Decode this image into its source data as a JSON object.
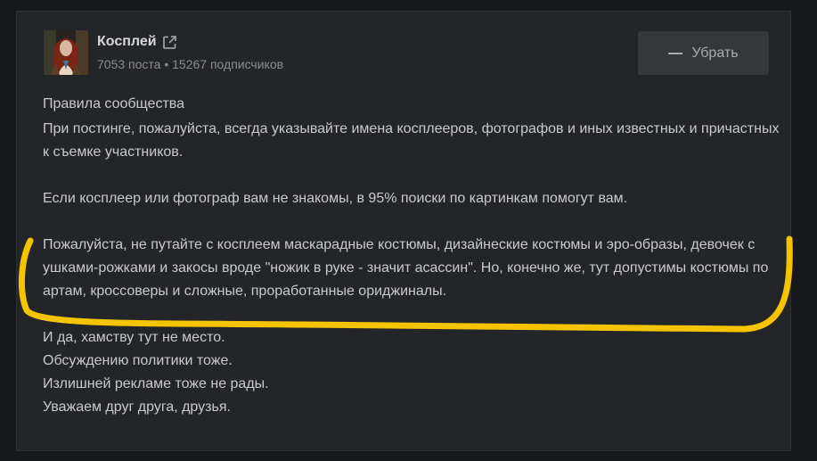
{
  "community": {
    "name": "Косплей",
    "posts": "7053 поста",
    "separator": "•",
    "subscribers": "15267 подписчиков"
  },
  "actions": {
    "remove_label": "Убрать"
  },
  "rules": {
    "title": "Правила сообщества",
    "paragraph_1": "При постинге, пожалуйста, всегда указывайте имена косплееров, фотографов и иных известных и причастных к съемке участников.",
    "paragraph_2": "Если косплеер или фотограф вам не знакомы, в 95% поиски по картинкам помогут вам.",
    "paragraph_3": "Пожалуйста, не путайте с косплеем маскарадные костюмы, дизайнеские костюмы и эро-образы, девочек с ушками-рожками и закосы вроде \"ножик в руке - значит асассин\". Но, конечно же, тут допустимы костюмы по артам, кроссоверы и сложные, проработанные ориджиналы.",
    "line_1": "И да, хамству тут не место.",
    "line_2": "Обсуждению политики тоже.",
    "line_3": "Излишней рекламе тоже не рады.",
    "line_4": "Уважаем друг друга, друзья."
  },
  "colors": {
    "page_bg": "#17181b",
    "card_bg": "#242529",
    "text": "#c9cace",
    "muted": "#8b8d92",
    "highlight_stroke": "#f5c400"
  },
  "icons": {
    "external_link": "external-link-icon",
    "remove": "minus-icon"
  }
}
